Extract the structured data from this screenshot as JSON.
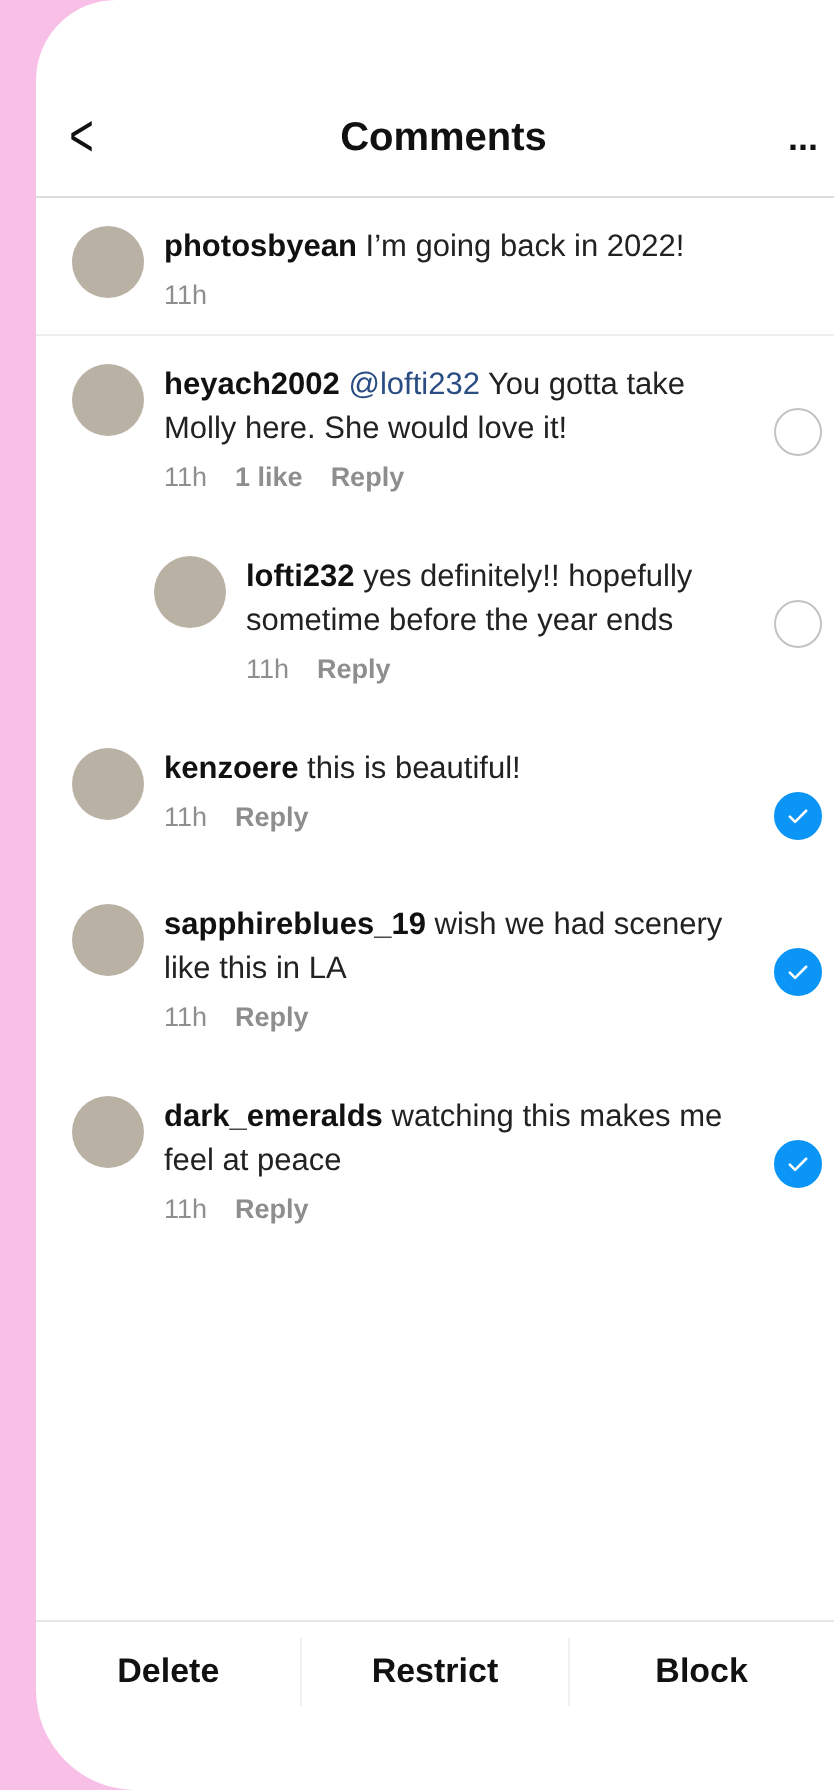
{
  "header": {
    "back": "<",
    "title": "Comments",
    "more": "..."
  },
  "comments": [
    {
      "kind": "caption",
      "username": "photosbyean",
      "text": "I’m going back in 2022!",
      "time": "11h"
    },
    {
      "kind": "comment",
      "username": "heyach2002",
      "mention": "@lofti232",
      "text": "You gotta take Molly here. She would love it!",
      "time": "11h",
      "likes": "1 like",
      "reply": "Reply",
      "selected": false,
      "children": [
        {
          "kind": "comment",
          "username": "lofti232",
          "text": "yes definitely!! hopefully sometime before the year ends",
          "time": "11h",
          "reply": "Reply",
          "selected": false
        }
      ]
    },
    {
      "kind": "comment",
      "username": "kenzoere",
      "text": "this is beautiful!",
      "time": "11h",
      "reply": "Reply",
      "selected": true
    },
    {
      "kind": "comment",
      "username": "sapphireblues_19",
      "text": "wish we had scenery like this in LA",
      "time": "11h",
      "reply": "Reply",
      "selected": true
    },
    {
      "kind": "comment",
      "username": "dark_emeralds",
      "text": "watching this makes me feel at peace",
      "time": "11h",
      "reply": "Reply",
      "selected": true
    }
  ],
  "actions": [
    "Delete",
    "Restrict",
    "Block"
  ]
}
